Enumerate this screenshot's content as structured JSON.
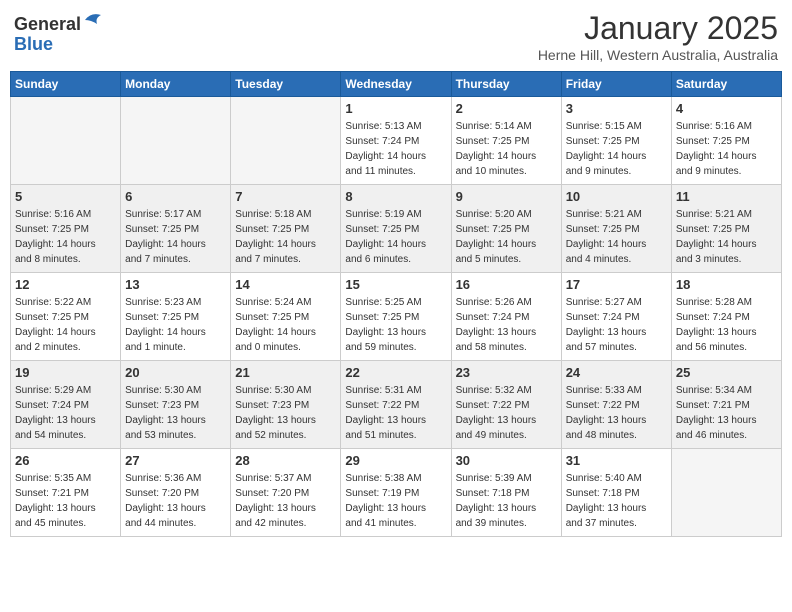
{
  "header": {
    "logo_line1": "General",
    "logo_line2": "Blue",
    "month": "January 2025",
    "location": "Herne Hill, Western Australia, Australia"
  },
  "weekdays": [
    "Sunday",
    "Monday",
    "Tuesday",
    "Wednesday",
    "Thursday",
    "Friday",
    "Saturday"
  ],
  "weeks": [
    [
      {
        "day": "",
        "info": ""
      },
      {
        "day": "",
        "info": ""
      },
      {
        "day": "",
        "info": ""
      },
      {
        "day": "1",
        "info": "Sunrise: 5:13 AM\nSunset: 7:24 PM\nDaylight: 14 hours\nand 11 minutes."
      },
      {
        "day": "2",
        "info": "Sunrise: 5:14 AM\nSunset: 7:25 PM\nDaylight: 14 hours\nand 10 minutes."
      },
      {
        "day": "3",
        "info": "Sunrise: 5:15 AM\nSunset: 7:25 PM\nDaylight: 14 hours\nand 9 minutes."
      },
      {
        "day": "4",
        "info": "Sunrise: 5:16 AM\nSunset: 7:25 PM\nDaylight: 14 hours\nand 9 minutes."
      }
    ],
    [
      {
        "day": "5",
        "info": "Sunrise: 5:16 AM\nSunset: 7:25 PM\nDaylight: 14 hours\nand 8 minutes."
      },
      {
        "day": "6",
        "info": "Sunrise: 5:17 AM\nSunset: 7:25 PM\nDaylight: 14 hours\nand 7 minutes."
      },
      {
        "day": "7",
        "info": "Sunrise: 5:18 AM\nSunset: 7:25 PM\nDaylight: 14 hours\nand 7 minutes."
      },
      {
        "day": "8",
        "info": "Sunrise: 5:19 AM\nSunset: 7:25 PM\nDaylight: 14 hours\nand 6 minutes."
      },
      {
        "day": "9",
        "info": "Sunrise: 5:20 AM\nSunset: 7:25 PM\nDaylight: 14 hours\nand 5 minutes."
      },
      {
        "day": "10",
        "info": "Sunrise: 5:21 AM\nSunset: 7:25 PM\nDaylight: 14 hours\nand 4 minutes."
      },
      {
        "day": "11",
        "info": "Sunrise: 5:21 AM\nSunset: 7:25 PM\nDaylight: 14 hours\nand 3 minutes."
      }
    ],
    [
      {
        "day": "12",
        "info": "Sunrise: 5:22 AM\nSunset: 7:25 PM\nDaylight: 14 hours\nand 2 minutes."
      },
      {
        "day": "13",
        "info": "Sunrise: 5:23 AM\nSunset: 7:25 PM\nDaylight: 14 hours\nand 1 minute."
      },
      {
        "day": "14",
        "info": "Sunrise: 5:24 AM\nSunset: 7:25 PM\nDaylight: 14 hours\nand 0 minutes."
      },
      {
        "day": "15",
        "info": "Sunrise: 5:25 AM\nSunset: 7:25 PM\nDaylight: 13 hours\nand 59 minutes."
      },
      {
        "day": "16",
        "info": "Sunrise: 5:26 AM\nSunset: 7:24 PM\nDaylight: 13 hours\nand 58 minutes."
      },
      {
        "day": "17",
        "info": "Sunrise: 5:27 AM\nSunset: 7:24 PM\nDaylight: 13 hours\nand 57 minutes."
      },
      {
        "day": "18",
        "info": "Sunrise: 5:28 AM\nSunset: 7:24 PM\nDaylight: 13 hours\nand 56 minutes."
      }
    ],
    [
      {
        "day": "19",
        "info": "Sunrise: 5:29 AM\nSunset: 7:24 PM\nDaylight: 13 hours\nand 54 minutes."
      },
      {
        "day": "20",
        "info": "Sunrise: 5:30 AM\nSunset: 7:23 PM\nDaylight: 13 hours\nand 53 minutes."
      },
      {
        "day": "21",
        "info": "Sunrise: 5:30 AM\nSunset: 7:23 PM\nDaylight: 13 hours\nand 52 minutes."
      },
      {
        "day": "22",
        "info": "Sunrise: 5:31 AM\nSunset: 7:22 PM\nDaylight: 13 hours\nand 51 minutes."
      },
      {
        "day": "23",
        "info": "Sunrise: 5:32 AM\nSunset: 7:22 PM\nDaylight: 13 hours\nand 49 minutes."
      },
      {
        "day": "24",
        "info": "Sunrise: 5:33 AM\nSunset: 7:22 PM\nDaylight: 13 hours\nand 48 minutes."
      },
      {
        "day": "25",
        "info": "Sunrise: 5:34 AM\nSunset: 7:21 PM\nDaylight: 13 hours\nand 46 minutes."
      }
    ],
    [
      {
        "day": "26",
        "info": "Sunrise: 5:35 AM\nSunset: 7:21 PM\nDaylight: 13 hours\nand 45 minutes."
      },
      {
        "day": "27",
        "info": "Sunrise: 5:36 AM\nSunset: 7:20 PM\nDaylight: 13 hours\nand 44 minutes."
      },
      {
        "day": "28",
        "info": "Sunrise: 5:37 AM\nSunset: 7:20 PM\nDaylight: 13 hours\nand 42 minutes."
      },
      {
        "day": "29",
        "info": "Sunrise: 5:38 AM\nSunset: 7:19 PM\nDaylight: 13 hours\nand 41 minutes."
      },
      {
        "day": "30",
        "info": "Sunrise: 5:39 AM\nSunset: 7:18 PM\nDaylight: 13 hours\nand 39 minutes."
      },
      {
        "day": "31",
        "info": "Sunrise: 5:40 AM\nSunset: 7:18 PM\nDaylight: 13 hours\nand 37 minutes."
      },
      {
        "day": "",
        "info": ""
      }
    ]
  ]
}
